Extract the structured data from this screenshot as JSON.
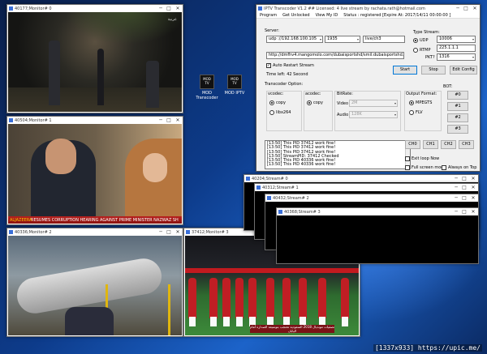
{
  "monitors": [
    {
      "title": "40177;Monitor# 0",
      "logo": "عربية"
    },
    {
      "title": "40504;Monitor# 1",
      "ticker": "RESUMES CORRUPTION HEARING AGAINST PRIME MINISTER NAZWAZ SH",
      "brand": "ALJAZEERA"
    },
    {
      "title": "40336;Monitor# 2"
    },
    {
      "title": "37412;Monitor# 3",
      "caption": "تصفيات مونديال 2018 السعودية تحتجب بتوسيعة الصدارة أمام اليابان",
      "chan": "OD"
    }
  ],
  "desktop_icons": [
    {
      "label": "MOD Transcoder",
      "glyph": "MOD TV"
    },
    {
      "label": "MOD IPTV",
      "glyph": "MOD TV"
    }
  ],
  "transcoder": {
    "title": "IPTV Transcoder V1.2 ## Licensed: 4 live stream by rachata.rath@hotmail.com",
    "menu": [
      "Program",
      "Get Unlocked",
      "View My ID",
      "Status : registered [Expire At: 2017/14/11 00:00:00 ]"
    ],
    "server_label": "Server:",
    "server_proto": "udp ://192.168.100.105",
    "server_port": "1935",
    "server_path": "live/ch3",
    "url": "http://dmfhv4.mangomolo.com/dubaisportshd/smil:dubaisportshd.smil/chun",
    "auto_restart_label": "Auto Restart Stream",
    "time_left": "Time left:  42  Second",
    "type_stream_label": "Type Stream:",
    "udp_label": "UDP",
    "rtmp_label": "RTMP",
    "type_port": "10006",
    "type_addr": "225.1.1.1",
    "pkt_label": "PKT?",
    "pkt_value": "1316",
    "start_label": "Start",
    "stop_label": "Stop",
    "edit_config_label": "Edit Config",
    "transcoder_option_label": "Transcoder Option:",
    "vcodec_label": "vcodec:",
    "vcodec_copy": "copy",
    "vcodec_x264": "libx264",
    "acodec_label": "acodec:",
    "acodec_copy": "copy",
    "bitrate_label": "BitRate:",
    "video_label": "Video",
    "video_value": "2M",
    "audio_label": "Audio",
    "audio_value": "128K",
    "output_format_label": "Output Format:",
    "mpegts_label": "MPEGTS",
    "flv_label": "FLV",
    "bot_label": "BOT:",
    "bot_buttons": [
      "#0",
      "#1",
      "#2",
      "#3"
    ],
    "ch_buttons": [
      "CH0",
      "CH1",
      "CH2",
      "CH3"
    ],
    "log_lines": [
      "[13:50] This PID 37412 work fine!",
      "[13:50] This PID 37412 work fine!",
      "[13:50] This PID 37412 work fine!",
      "[13:50] StreamPID: 37412 Checked",
      "[13:50] This PID 40336 work fine!",
      "[13:50] This PID 40336 work fine!"
    ],
    "exit_loop_label": "Exit loop Now",
    "fullscreen_label": "Full screen mode",
    "always_top_label": "Always on Top"
  },
  "streams": [
    {
      "title": "40204;Stream# 0"
    },
    {
      "title": "40312;Stream# 1"
    },
    {
      "title": "40432;Stream# 2"
    },
    {
      "title": "40368;Stream# 3"
    }
  ],
  "watermark": "[1337x933] https://upic.me/",
  "colors": {
    "ticker": "#b8201e",
    "jersey": "#c01e24",
    "accent": "#0078d7"
  }
}
